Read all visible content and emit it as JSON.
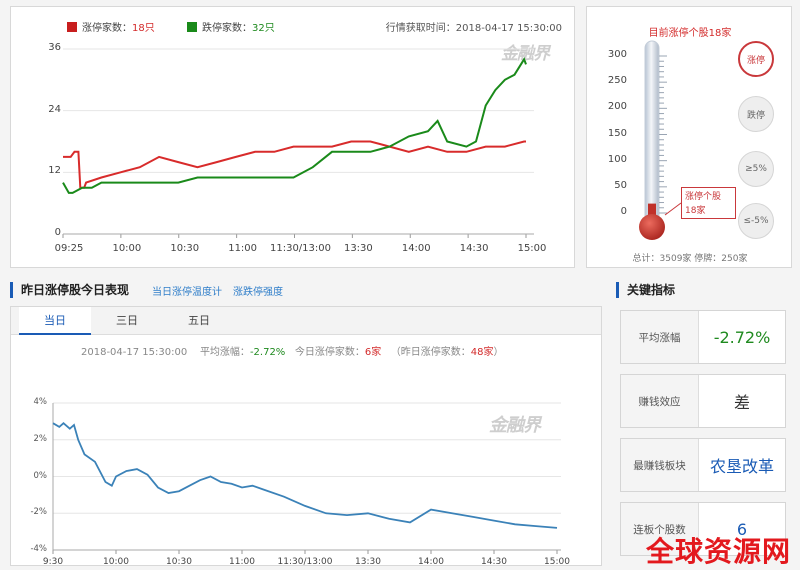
{
  "limit_chart": {
    "legend_up": {
      "label": "涨停家数：",
      "value": "18只",
      "color": "#c81e1e"
    },
    "legend_down": {
      "label": "跌停家数：",
      "value": "32只",
      "color": "#1a8a1a"
    },
    "fetch_time": "行情获取时间：2018-04-17 15:30:00",
    "watermark": "金融界"
  },
  "thermometer": {
    "title": "目前涨停个股18家",
    "scale": [
      "300",
      "250",
      "200",
      "150",
      "100",
      "50",
      "0"
    ],
    "buttons": [
      {
        "label": "涨停",
        "active": true
      },
      {
        "label": "跌停",
        "active": false
      },
      {
        "label": "≥5%",
        "active": false
      },
      {
        "label": "≤-5%",
        "active": false
      }
    ],
    "tip_line1": "涨停个股",
    "tip_line2": "18家",
    "level": 18,
    "footer": "总计：3509家 停牌：250家"
  },
  "performance": {
    "title": "昨日涨停股今日表现",
    "links": [
      "当日涨停温度计",
      "涨跌停强度"
    ],
    "tabs": [
      {
        "label": "当日",
        "active": true
      },
      {
        "label": "三日",
        "active": false
      },
      {
        "label": "五日",
        "active": false
      }
    ],
    "date": "2018-04-17 15:30:00",
    "avg_label": "平均涨幅：",
    "avg_value": "-2.72%",
    "today_label": "今日涨停家数：",
    "today_value": "6家",
    "yesterday_label": "（昨日涨停家数：",
    "yesterday_value": "48家",
    "yesterday_close": "）",
    "watermark": "金融界"
  },
  "key_metrics": {
    "title": "关键指标",
    "items": [
      {
        "label": "平均涨幅",
        "value": "-2.72%",
        "color": "#1f8a1f"
      },
      {
        "label": "赚钱效应",
        "value": "差",
        "color": "#333333"
      },
      {
        "label": "最赚钱板块",
        "value": "农垦改革",
        "color": "#1a5bb5"
      },
      {
        "label": "连板个股数",
        "value": "6",
        "color": "#1a5bb5"
      }
    ]
  },
  "site_watermark": "全球资源网",
  "chart_data": [
    {
      "type": "line",
      "title": "",
      "x_ticks": [
        "09:25",
        "10:00",
        "10:30",
        "11:00",
        "11:30/13:00",
        "13:30",
        "14:00",
        "14:30",
        "15:00"
      ],
      "y_ticks": [
        "0",
        "12",
        "24",
        "36"
      ],
      "ylim": [
        0,
        36
      ],
      "series": [
        {
          "name": "涨停家数",
          "color": "#d82b2b",
          "x": [
            0,
            4,
            6,
            8,
            9,
            11,
            12,
            20,
            30,
            40,
            50,
            60,
            70,
            80,
            90,
            100,
            110,
            120,
            130,
            140,
            150,
            160,
            170,
            180,
            190,
            200,
            210,
            220,
            230,
            240,
            241
          ],
          "values": [
            15,
            15,
            16,
            16,
            9,
            9,
            10,
            11,
            12,
            13,
            15,
            14,
            13,
            14,
            15,
            16,
            16,
            17,
            17,
            17,
            18,
            18,
            17,
            16,
            17,
            16,
            16,
            17,
            17,
            18,
            18
          ]
        },
        {
          "name": "跌停家数",
          "color": "#1a8a1a",
          "x": [
            0,
            3,
            5,
            10,
            15,
            20,
            30,
            40,
            50,
            60,
            70,
            80,
            90,
            100,
            110,
            120,
            130,
            140,
            150,
            160,
            170,
            180,
            190,
            195,
            200,
            210,
            215,
            220,
            225,
            230,
            235,
            240,
            241
          ],
          "values": [
            10,
            8,
            8,
            9,
            9,
            10,
            10,
            10,
            10,
            10,
            11,
            11,
            11,
            11,
            11,
            11,
            13,
            16,
            16,
            16,
            17,
            19,
            20,
            22,
            18,
            17,
            18,
            25,
            28,
            30,
            31,
            34,
            33
          ]
        }
      ]
    },
    {
      "type": "line",
      "title": "",
      "x_ticks": [
        "9:30",
        "10:00",
        "10:30",
        "11:00",
        "11:30/13:00",
        "13:30",
        "14:00",
        "14:30",
        "15:00"
      ],
      "y_ticks": [
        "4%",
        "2%",
        "0%",
        "-2%",
        "-4%"
      ],
      "ylim": [
        -4,
        4
      ],
      "series": [
        {
          "name": "平均涨幅",
          "color": "#3b82b8",
          "x": [
            0,
            3,
            5,
            8,
            10,
            12,
            15,
            20,
            25,
            28,
            30,
            35,
            40,
            45,
            50,
            55,
            60,
            65,
            70,
            75,
            80,
            85,
            90,
            95,
            100,
            110,
            120,
            130,
            140,
            150,
            160,
            170,
            180,
            190,
            200,
            210,
            220,
            230,
            240
          ],
          "values": [
            2.9,
            2.7,
            2.9,
            2.6,
            2.8,
            2.0,
            1.2,
            0.8,
            -0.3,
            -0.5,
            0.0,
            0.3,
            0.4,
            0.1,
            -0.6,
            -0.9,
            -0.8,
            -0.5,
            -0.2,
            0.0,
            -0.3,
            -0.4,
            -0.6,
            -0.5,
            -0.7,
            -1.1,
            -1.6,
            -2.0,
            -2.1,
            -2.0,
            -2.3,
            -2.5,
            -1.8,
            -2.0,
            -2.2,
            -2.4,
            -2.6,
            -2.7,
            -2.8
          ]
        }
      ]
    }
  ]
}
